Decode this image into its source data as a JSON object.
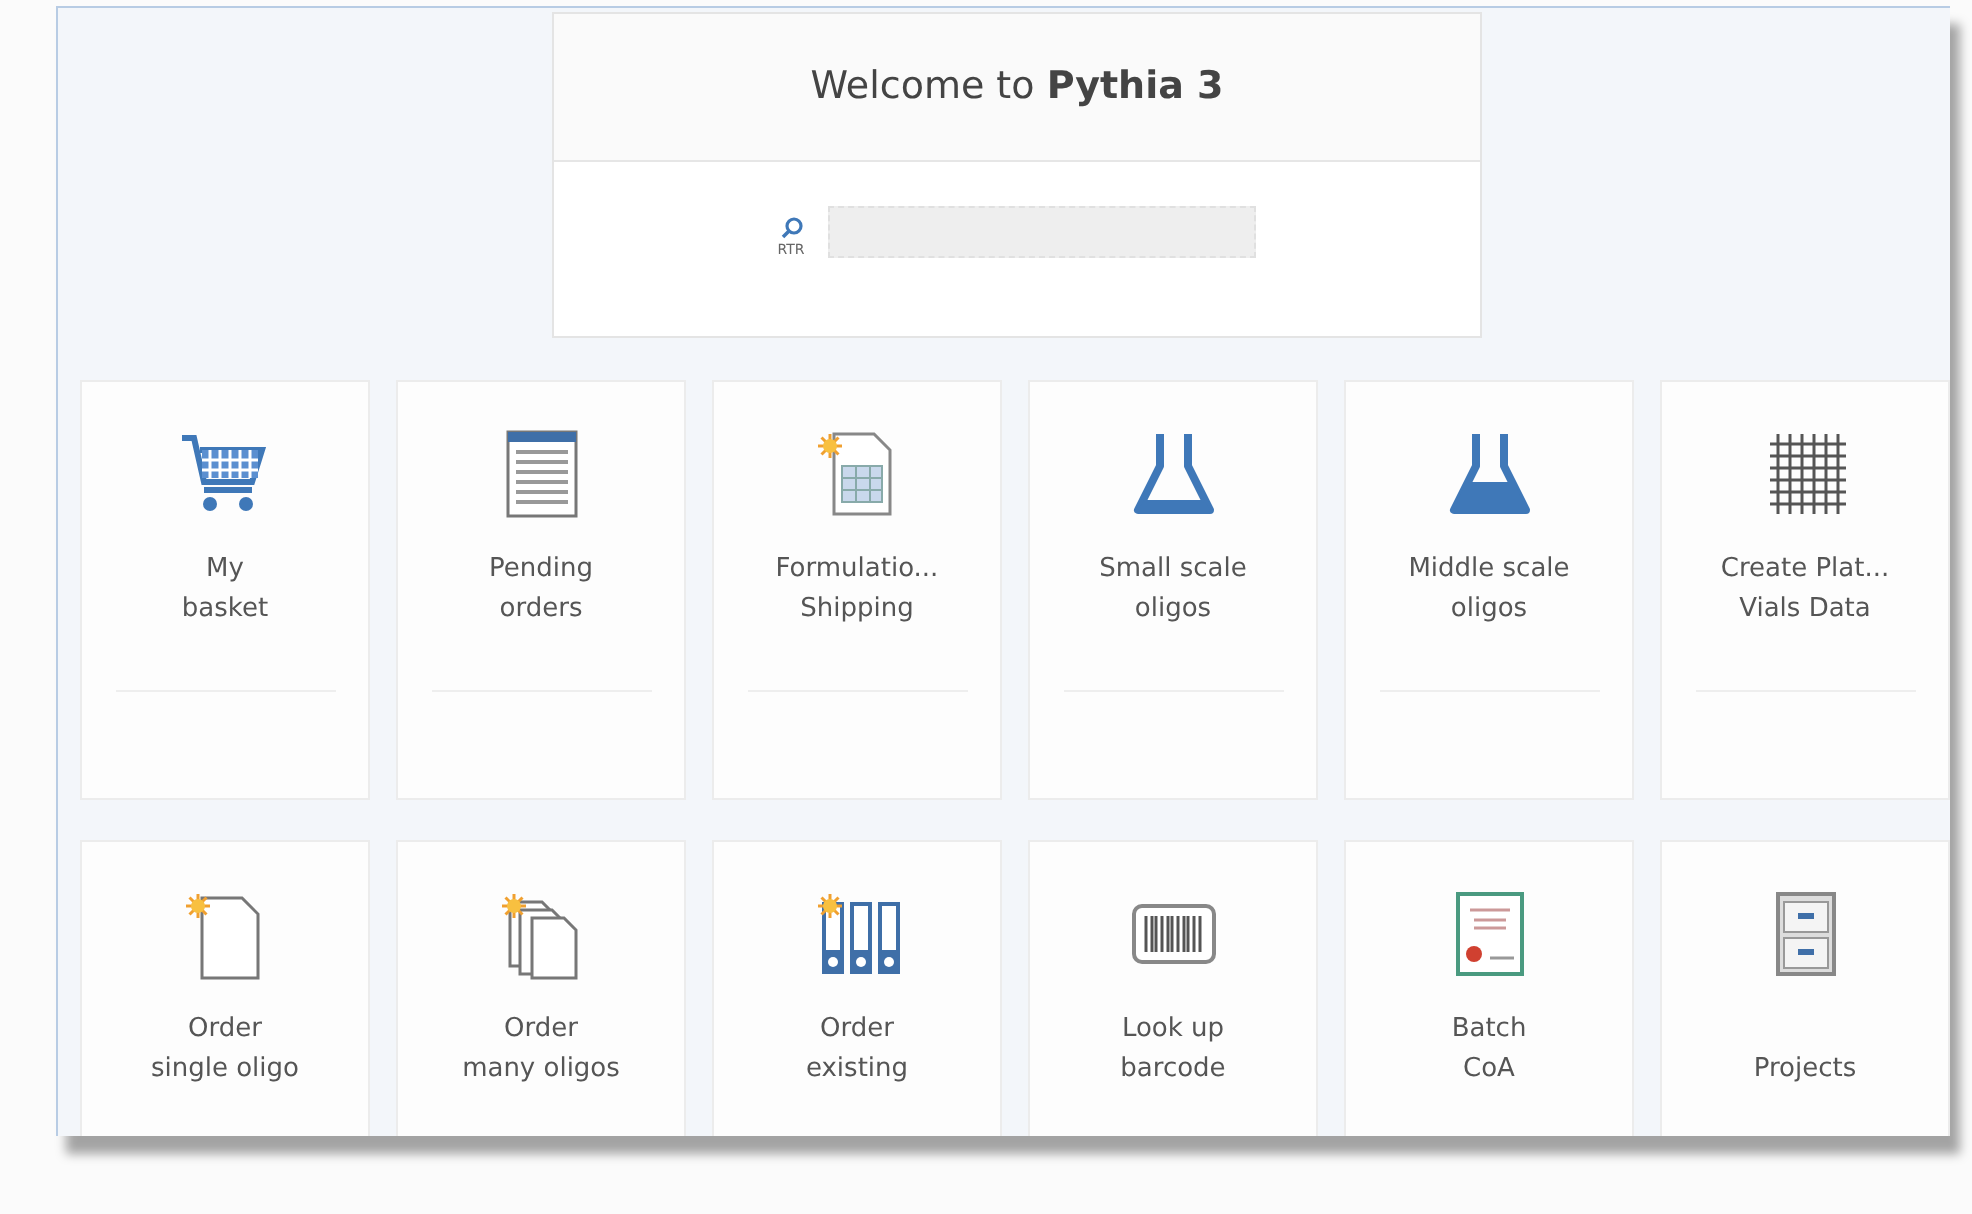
{
  "header": {
    "title": "Welcome to **Pythia 3**",
    "search": {
      "label": "RTR"
    }
  },
  "tiles": [
    {
      "lines": [
        "My",
        "basket"
      ]
    },
    {
      "lines": [
        "Pending",
        "orders"
      ]
    },
    {
      "lines": [
        "Formulatio...",
        "Shipping"
      ]
    },
    {
      "lines": [
        "Small scale",
        "oligos"
      ]
    },
    {
      "lines": [
        "Middle scale",
        "oligos"
      ]
    },
    {
      "lines": [
        "Create Plat...",
        "Vials Data"
      ]
    },
    {
      "lines": [
        "Order",
        "single oligo"
      ]
    },
    {
      "lines": [
        "Order",
        "many oligos"
      ]
    },
    {
      "lines": [
        "Order",
        "existing"
      ]
    },
    {
      "lines": [
        "Look up",
        "barcode"
      ]
    },
    {
      "lines": [
        "Batch",
        "CoA"
      ]
    },
    {
      "lines": [
        "Projects"
      ]
    }
  ]
}
